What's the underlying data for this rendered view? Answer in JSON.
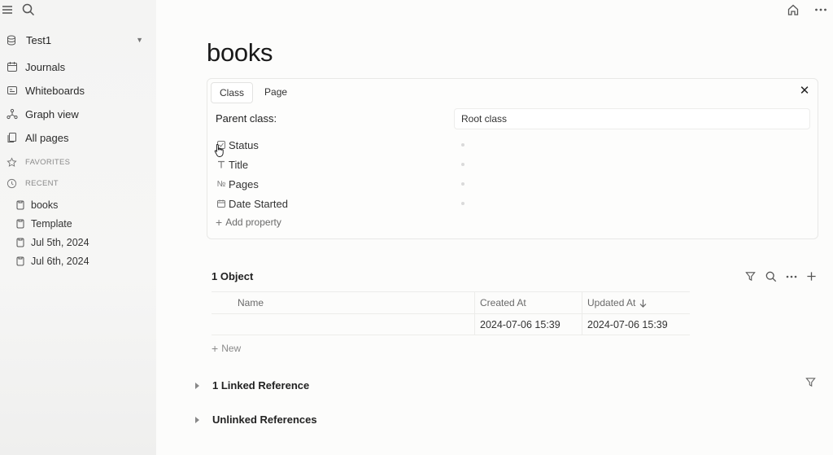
{
  "sidebar": {
    "workspace": "Test1",
    "nav": [
      {
        "label": "Journals",
        "icon": "calendar-icon"
      },
      {
        "label": "Whiteboards",
        "icon": "whiteboard-icon"
      },
      {
        "label": "Graph view",
        "icon": "graph-icon"
      },
      {
        "label": "All pages",
        "icon": "pages-icon"
      }
    ],
    "favorites_label": "FAVORITES",
    "recent_label": "RECENT",
    "recent": [
      "books",
      "Template",
      "Jul 5th, 2024",
      "Jul 6th, 2024"
    ]
  },
  "page": {
    "title": "books",
    "tabs": [
      "Class",
      "Page"
    ],
    "parent_class_label": "Parent class:",
    "parent_class_value": "Root class",
    "properties": [
      {
        "label": "Status",
        "icon": "checkbox-icon"
      },
      {
        "label": "Title",
        "icon": "text-icon"
      },
      {
        "label": "Pages",
        "icon": "number-icon"
      },
      {
        "label": "Date Started",
        "icon": "date-icon"
      }
    ],
    "add_property": "Add property",
    "number_glyph": "№"
  },
  "objects": {
    "title": "1 Object",
    "columns": [
      "Name",
      "Created At",
      "Updated At"
    ],
    "rows": [
      {
        "name": "",
        "created": "2024-07-06 15:39",
        "updated": "2024-07-06 15:39"
      }
    ],
    "new_label": "New"
  },
  "references": {
    "linked": "1 Linked Reference",
    "unlinked": "Unlinked References"
  }
}
